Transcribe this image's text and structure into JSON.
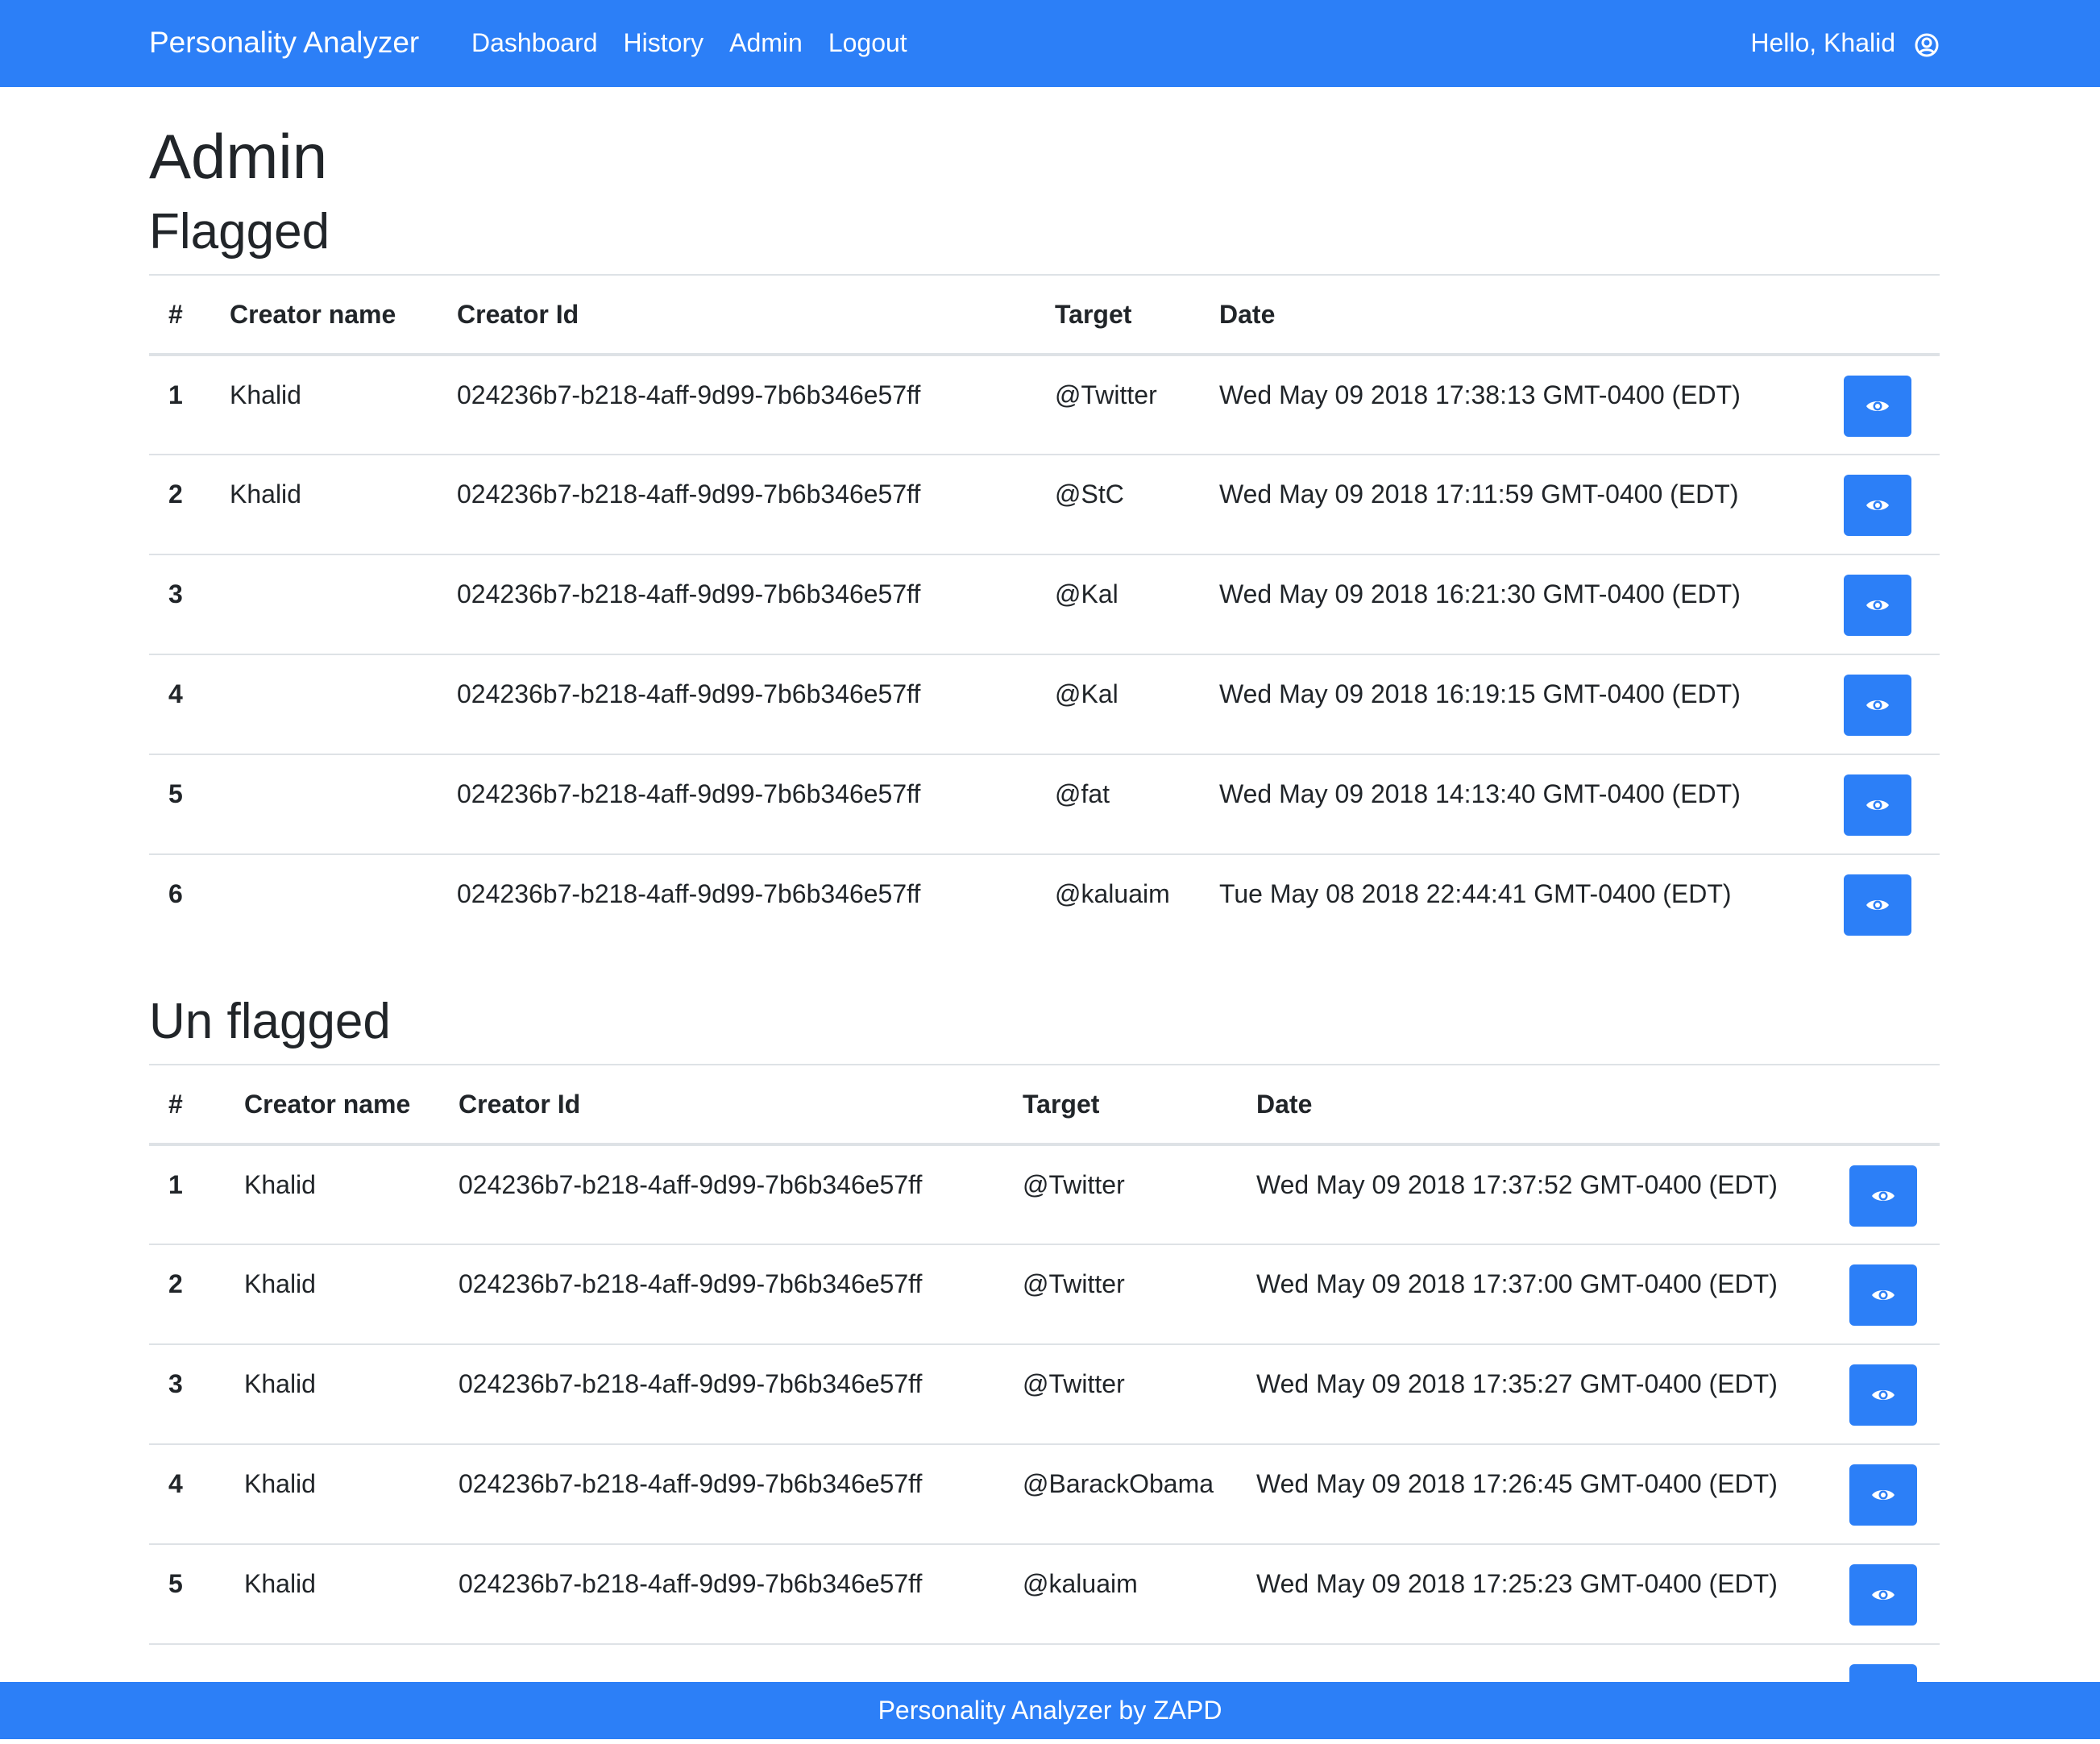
{
  "navbar": {
    "brand": "Personality Analyzer",
    "links": [
      "Dashboard",
      "History",
      "Admin",
      "Logout"
    ],
    "greeting": "Hello, Khalid",
    "user_icon": "user-circle-icon"
  },
  "page": {
    "title": "Admin"
  },
  "flagged": {
    "title": "Flagged",
    "headers": [
      "#",
      "Creator name",
      "Creator Id",
      "Target",
      "Date"
    ],
    "rows": [
      {
        "num": "1",
        "creator_name": "Khalid",
        "creator_id": "024236b7-b218-4aff-9d99-7b6b346e57ff",
        "target": "@Twitter",
        "date": "Wed May 09 2018 17:38:13 GMT-0400 (EDT)"
      },
      {
        "num": "2",
        "creator_name": "Khalid",
        "creator_id": "024236b7-b218-4aff-9d99-7b6b346e57ff",
        "target": "@StC",
        "date": "Wed May 09 2018 17:11:59 GMT-0400 (EDT)"
      },
      {
        "num": "3",
        "creator_name": "",
        "creator_id": "024236b7-b218-4aff-9d99-7b6b346e57ff",
        "target": "@Kal",
        "date": "Wed May 09 2018 16:21:30 GMT-0400 (EDT)"
      },
      {
        "num": "4",
        "creator_name": "",
        "creator_id": "024236b7-b218-4aff-9d99-7b6b346e57ff",
        "target": "@Kal",
        "date": "Wed May 09 2018 16:19:15 GMT-0400 (EDT)"
      },
      {
        "num": "5",
        "creator_name": "",
        "creator_id": "024236b7-b218-4aff-9d99-7b6b346e57ff",
        "target": "@fat",
        "date": "Wed May 09 2018 14:13:40 GMT-0400 (EDT)"
      },
      {
        "num": "6",
        "creator_name": "",
        "creator_id": "024236b7-b218-4aff-9d99-7b6b346e57ff",
        "target": "@kaluaim",
        "date": "Tue May 08 2018 22:44:41 GMT-0400 (EDT)"
      }
    ]
  },
  "unflagged": {
    "title": "Un flagged",
    "headers": [
      "#",
      "Creator name",
      "Creator Id",
      "Target",
      "Date"
    ],
    "rows": [
      {
        "num": "1",
        "creator_name": "Khalid",
        "creator_id": "024236b7-b218-4aff-9d99-7b6b346e57ff",
        "target": "@Twitter",
        "date": "Wed May 09 2018 17:37:52 GMT-0400 (EDT)"
      },
      {
        "num": "2",
        "creator_name": "Khalid",
        "creator_id": "024236b7-b218-4aff-9d99-7b6b346e57ff",
        "target": "@Twitter",
        "date": "Wed May 09 2018 17:37:00 GMT-0400 (EDT)"
      },
      {
        "num": "3",
        "creator_name": "Khalid",
        "creator_id": "024236b7-b218-4aff-9d99-7b6b346e57ff",
        "target": "@Twitter",
        "date": "Wed May 09 2018 17:35:27 GMT-0400 (EDT)"
      },
      {
        "num": "4",
        "creator_name": "Khalid",
        "creator_id": "024236b7-b218-4aff-9d99-7b6b346e57ff",
        "target": "@BarackObama",
        "date": "Wed May 09 2018 17:26:45 GMT-0400 (EDT)"
      },
      {
        "num": "5",
        "creator_name": "Khalid",
        "creator_id": "024236b7-b218-4aff-9d99-7b6b346e57ff",
        "target": "@kaluaim",
        "date": "Wed May 09 2018 17:25:23 GMT-0400 (EDT)"
      }
    ]
  },
  "view_button_icon": "eye-icon",
  "footer": {
    "text": "Personality Analyzer by ZAPD"
  },
  "colors": {
    "primary": "#2c7ff7",
    "text": "#212529",
    "border": "#dee2e6"
  }
}
